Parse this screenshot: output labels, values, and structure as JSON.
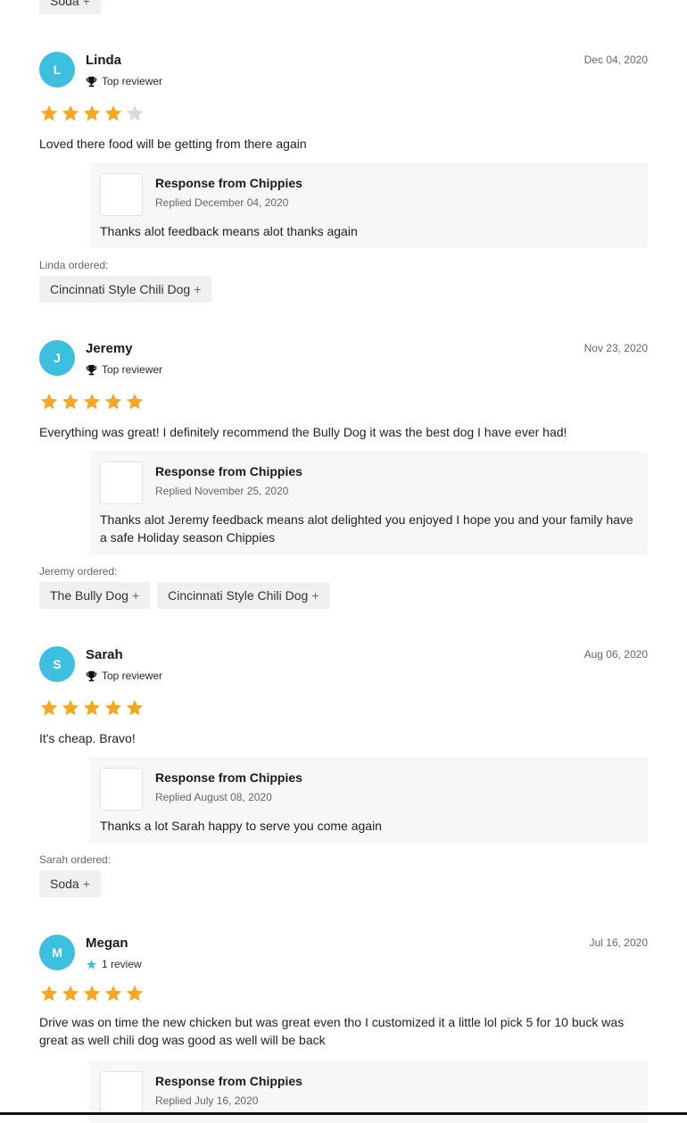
{
  "top_fragment": {
    "tag": "Soda"
  },
  "plus_symbol": "+",
  "reviews": [
    {
      "initial": "L",
      "name": "Linda",
      "badge": "Top reviewer",
      "badge_icon": "trophy-icon",
      "date": "Dec 04, 2020",
      "rating": 4,
      "text": "Loved there food will be getting from there again",
      "response": {
        "title": "Response from Chippies",
        "date": "Replied December 04, 2020",
        "text": "Thanks alot feedback means alot thanks again"
      },
      "ordered_label": "Linda ordered:",
      "items": [
        "Cincinnati Style Chili Dog"
      ]
    },
    {
      "initial": "J",
      "name": "Jeremy",
      "badge": "Top reviewer",
      "badge_icon": "trophy-icon",
      "date": "Nov 23, 2020",
      "rating": 5,
      "text": "Everything was great! I definitely recommend the Bully Dog it was the best dog I have ever had!",
      "response": {
        "title": "Response from Chippies",
        "date": "Replied November 25, 2020",
        "text": "Thanks alot Jeremy feedback means alot delighted you enjoyed I hope you and your family have a safe Holiday season Chippies"
      },
      "ordered_label": "Jeremy ordered:",
      "items": [
        "The Bully Dog",
        "Cincinnati Style Chili Dog"
      ]
    },
    {
      "initial": "S",
      "name": "Sarah",
      "badge": "Top reviewer",
      "badge_icon": "trophy-icon",
      "date": "Aug 06, 2020",
      "rating": 5,
      "text": "It's cheap. Bravo!",
      "response": {
        "title": "Response from Chippies",
        "date": "Replied August 08, 2020",
        "text": "Thanks a lot Sarah happy to serve you come again"
      },
      "ordered_label": "Sarah ordered:",
      "items": [
        "Soda"
      ]
    },
    {
      "initial": "M",
      "name": "Megan",
      "badge": "1 review",
      "badge_icon": "star-icon",
      "date": "Jul 16, 2020",
      "rating": 5,
      "text": "Drive was on time the new chicken but was great even tho I customized it a little lol pick 5 for 10 buck was great as well chili dog was good as well will be back",
      "response": {
        "title": "Response from Chippies",
        "date": "Replied July 16, 2020",
        "text": ""
      },
      "ordered_label": "",
      "items": []
    }
  ],
  "colors": {
    "avatar": "#3dbfe0",
    "star_filled": "#f5a623",
    "star_empty": "#d9d9d9",
    "response_bg": "#f7f7f8",
    "tag_bg": "#f0f0f1"
  }
}
